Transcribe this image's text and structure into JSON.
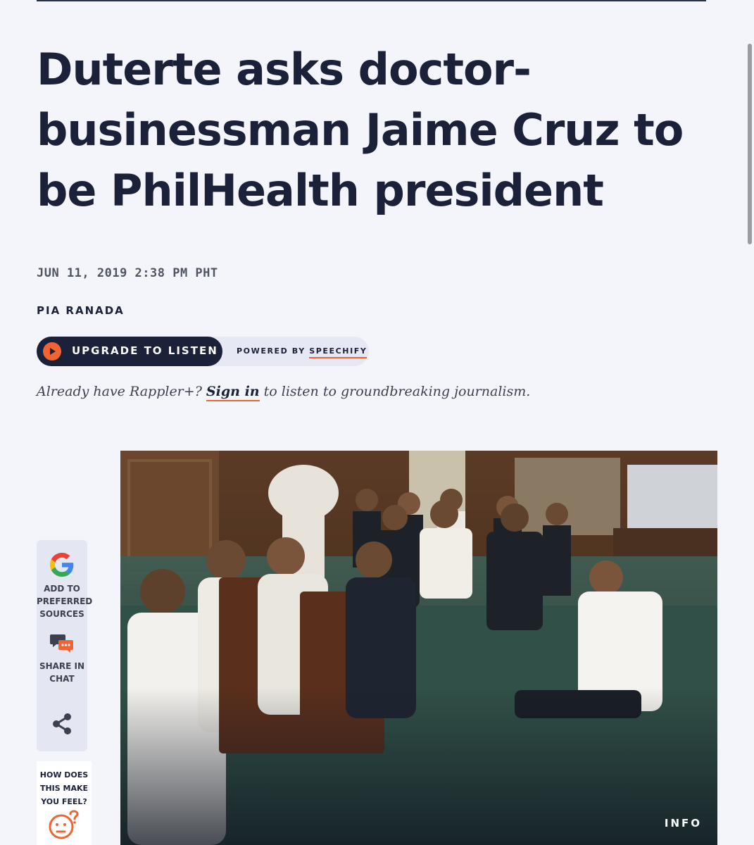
{
  "article": {
    "headline": "Duterte asks doctor-businessman Jaime Cruz to be PhilHealth president",
    "date": "JUN 11, 2019 2:38 PM PHT",
    "author": "PIA RANADA"
  },
  "audio": {
    "button_label": "UPGRADE TO LISTEN",
    "powered_prefix": "POWERED BY",
    "powered_brand": "SPEECHIFY"
  },
  "signin": {
    "prefix": "Already have Rappler+?",
    "link": "Sign in",
    "suffix": "to listen to groundbreaking journalism."
  },
  "share_rail": {
    "google_label": "ADD TO PREFERRED SOURCES",
    "chat_label": "SHARE IN CHAT",
    "share_icon": "share-icon"
  },
  "feel_widget": {
    "label": "HOW DOES THIS MAKE YOU FEEL?",
    "icon": "face-question-icon"
  },
  "photo": {
    "info_label": "INFO"
  },
  "colors": {
    "accent": "#f06434",
    "navy": "#1b2138",
    "background": "#f4f5fb"
  }
}
